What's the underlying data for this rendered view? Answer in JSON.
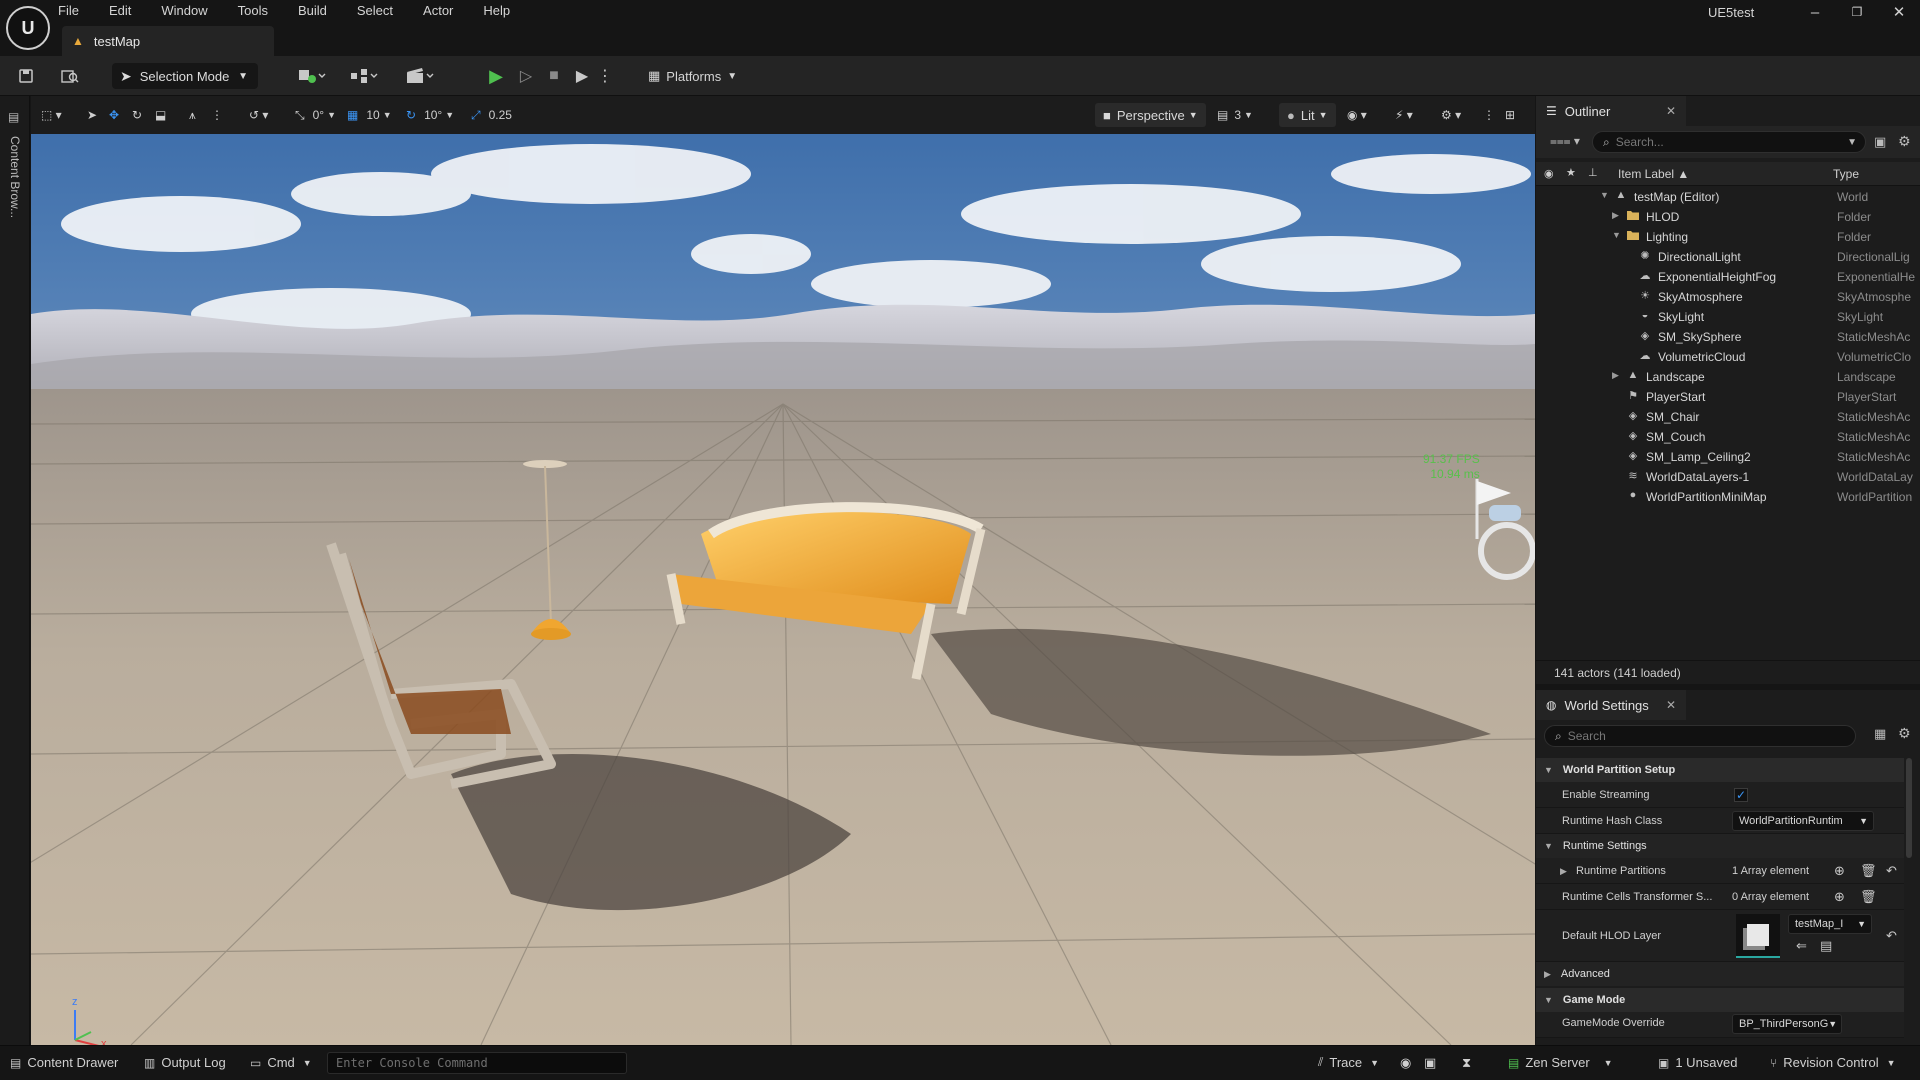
{
  "app": {
    "project_name": "UE5test",
    "logo_text": "U",
    "menu": [
      "File",
      "Edit",
      "Window",
      "Tools",
      "Build",
      "Select",
      "Actor",
      "Help"
    ],
    "document_tab": "testMap",
    "window_controls": {
      "minimize": "–",
      "restore": "❐",
      "close": "✕"
    }
  },
  "toolbar": {
    "selection_mode": "Selection Mode",
    "platforms": "Platforms"
  },
  "left_strip": {
    "content_browser_tab": "Content Brow..."
  },
  "viewport": {
    "snap_rotation": "0°",
    "grid_snap": "10",
    "angle_snap": "10°",
    "scale_snap": "0.25",
    "view_mode": "Perspective",
    "lighting": "Lit",
    "camera_speed": "3",
    "fps_line1": "91.37 FPS",
    "fps_line2": "10.94 ms",
    "axis_x": "x",
    "axis_z": "z"
  },
  "outliner": {
    "tab_title": "Outliner",
    "search_placeholder": "Search...",
    "col_item_label": "Item Label ▲",
    "col_type": "Type",
    "rows": [
      {
        "label": "testMap (Editor)",
        "type": "World",
        "depth": 0,
        "expander": "▼",
        "icon": "▲"
      },
      {
        "label": "HLOD",
        "type": "Folder",
        "depth": 1,
        "expander": "▶",
        "icon": "folder"
      },
      {
        "label": "Lighting",
        "type": "Folder",
        "depth": 1,
        "expander": "▼",
        "icon": "folder-open"
      },
      {
        "label": "DirectionalLight",
        "type": "DirectionalLig",
        "depth": 2,
        "expander": "",
        "icon": "✺"
      },
      {
        "label": "ExponentialHeightFog",
        "type": "ExponentialHe",
        "depth": 2,
        "expander": "",
        "icon": "☁"
      },
      {
        "label": "SkyAtmosphere",
        "type": "SkyAtmosphe",
        "depth": 2,
        "expander": "",
        "icon": "☀"
      },
      {
        "label": "SkyLight",
        "type": "SkyLight",
        "depth": 2,
        "expander": "",
        "icon": "◒"
      },
      {
        "label": "SM_SkySphere",
        "type": "StaticMeshAc",
        "depth": 2,
        "expander": "",
        "icon": "◈"
      },
      {
        "label": "VolumetricCloud",
        "type": "VolumetricClo",
        "depth": 2,
        "expander": "",
        "icon": "☁"
      },
      {
        "label": "Landscape",
        "type": "Landscape",
        "depth": 1,
        "expander": "▶",
        "icon": "▲"
      },
      {
        "label": "PlayerStart",
        "type": "PlayerStart",
        "depth": 1,
        "expander": "",
        "icon": "⚑"
      },
      {
        "label": "SM_Chair",
        "type": "StaticMeshAc",
        "depth": 1,
        "expander": "",
        "icon": "◈"
      },
      {
        "label": "SM_Couch",
        "type": "StaticMeshAc",
        "depth": 1,
        "expander": "",
        "icon": "◈"
      },
      {
        "label": "SM_Lamp_Ceiling2",
        "type": "StaticMeshAc",
        "depth": 1,
        "expander": "",
        "icon": "◈"
      },
      {
        "label": "WorldDataLayers-1",
        "type": "WorldDataLay",
        "depth": 1,
        "expander": "",
        "icon": "≋"
      },
      {
        "label": "WorldPartitionMiniMap",
        "type": "WorldPartition",
        "depth": 1,
        "expander": "",
        "icon": "●"
      }
    ],
    "actor_count": "141 actors (141 loaded)"
  },
  "world_settings": {
    "tab_title": "World Settings",
    "search_placeholder": "Search",
    "sections": {
      "world_partition_setup": "World Partition Setup",
      "runtime_settings": "Runtime Settings",
      "advanced": "Advanced",
      "game_mode": "Game Mode"
    },
    "props": {
      "enable_streaming": "Enable Streaming",
      "enable_streaming_value": "✓",
      "runtime_hash_class": "Runtime Hash Class",
      "runtime_hash_class_value": "WorldPartitionRuntim",
      "runtime_partitions": "Runtime Partitions",
      "runtime_partitions_value": "1 Array element",
      "runtime_cells_transformer": "Runtime Cells Transformer S...",
      "runtime_cells_transformer_value": "0 Array element",
      "default_hlod_layer": "Default HLOD Layer",
      "default_hlod_layer_value": "testMap_I",
      "gamemode_override": "GameMode Override",
      "gamemode_override_value": "BP_ThirdPersonG"
    }
  },
  "statusbar": {
    "content_drawer": "Content Drawer",
    "output_log": "Output Log",
    "cmd": "Cmd",
    "console_placeholder": "Enter Console Command",
    "trace": "Trace",
    "zen_server": "Zen Server",
    "unsaved": "1 Unsaved",
    "revision_control": "Revision Control"
  },
  "colors": {
    "accent_blue": "#3b95f5",
    "play_green": "#4fc04f",
    "fps_green": "#58c04b",
    "folder_yellow": "#d9b25a",
    "couch_orange": "#f0a630"
  }
}
